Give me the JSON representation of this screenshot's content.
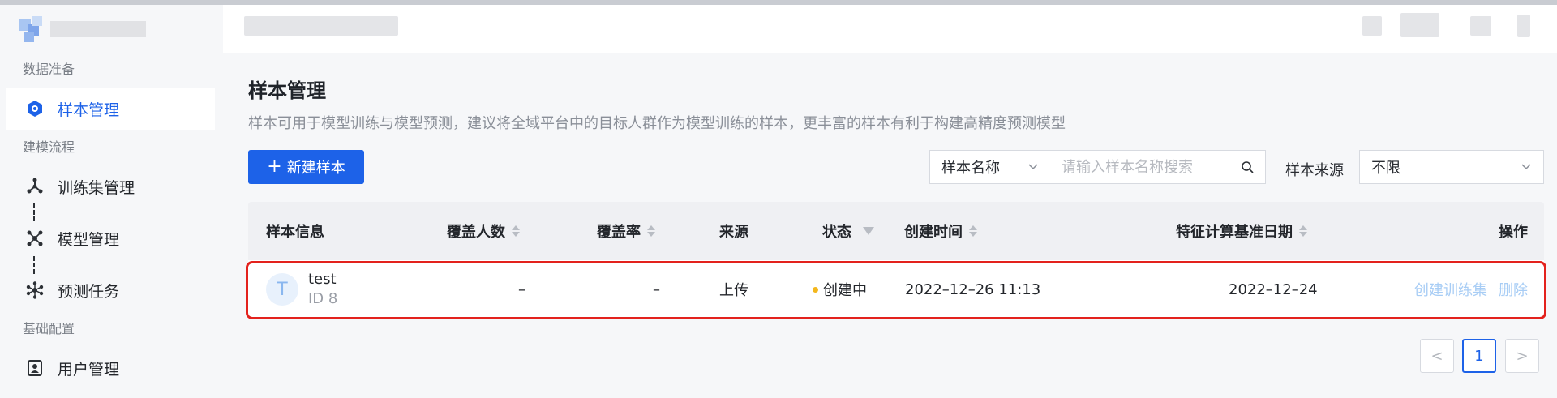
{
  "colors": {
    "accent": "#1d62e8",
    "highlight": "#e3221d",
    "status_creating": "#f3b71c"
  },
  "sidebar": {
    "sections": [
      {
        "label": "数据准备"
      },
      {
        "label": "建模流程"
      },
      {
        "label": "基础配置"
      }
    ],
    "items": [
      {
        "label": "样本管理",
        "icon": "sample-icon",
        "active": true
      },
      {
        "label": "训练集管理",
        "icon": "training-set-icon"
      },
      {
        "label": "模型管理",
        "icon": "model-icon"
      },
      {
        "label": "预测任务",
        "icon": "prediction-icon"
      },
      {
        "label": "用户管理",
        "icon": "user-icon"
      }
    ]
  },
  "main": {
    "title": "样本管理",
    "description": "样本可用于模型训练与模型预测，建议将全域平台中的目标人群作为模型训练的样本，更丰富的样本有利于构建高精度预测模型",
    "new_button": "新建样本",
    "search_field_select": "样本名称",
    "search_placeholder": "请输入样本名称搜索",
    "source_filter_label": "样本来源",
    "source_filter_value": "不限"
  },
  "table": {
    "headers": {
      "info": "样本信息",
      "coverage_count": "覆盖人数",
      "coverage_rate": "覆盖率",
      "source": "来源",
      "status": "状态",
      "created_at": "创建时间",
      "feature_date": "特征计算基准日期",
      "actions": "操作"
    },
    "rows": [
      {
        "avatar": "T",
        "name": "test",
        "id_text": "ID 8",
        "coverage_count": "–",
        "coverage_rate": "–",
        "source": "上传",
        "status": "创建中",
        "created_at": "2022–12–26 11:13",
        "feature_date": "2022–12–24",
        "action_create": "创建训练集",
        "action_delete": "删除"
      }
    ]
  },
  "pagination": {
    "prev": "<",
    "current": "1",
    "next": ">"
  }
}
